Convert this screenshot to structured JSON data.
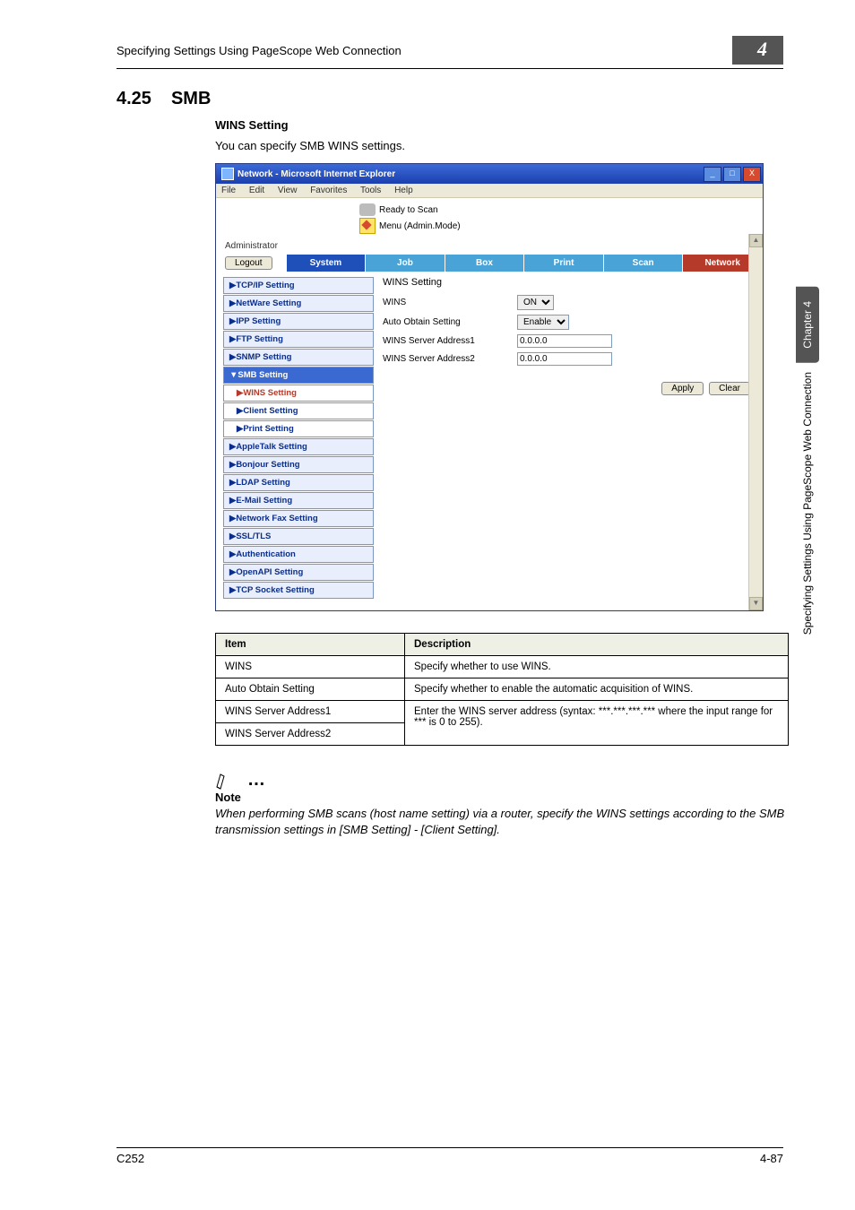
{
  "header": {
    "title": "Specifying Settings Using PageScope Web Connection",
    "badge": "4"
  },
  "section": {
    "number": "4.25",
    "name": "SMB"
  },
  "subheading": "WINS Setting",
  "intro": "You can specify SMB WINS settings.",
  "ie": {
    "title": "Network - Microsoft Internet Explorer",
    "menus": [
      "File",
      "Edit",
      "View",
      "Favorites",
      "Tools",
      "Help"
    ],
    "status1": "Ready to Scan",
    "status2": "Menu (Admin.Mode)",
    "admin_label": "Administrator",
    "logout": "Logout",
    "tabs": {
      "system": "System",
      "job": "Job",
      "box": "Box",
      "print": "Print",
      "scan": "Scan",
      "network": "Network"
    },
    "sidebar": {
      "tcpip": "TCP/IP Setting",
      "netware": "NetWare Setting",
      "ipp": "IPP Setting",
      "ftp": "FTP Setting",
      "snmp": "SNMP Setting",
      "smb": "SMB Setting",
      "wins": "WINS Setting",
      "client": "Client Setting",
      "print": "Print Setting",
      "appletalk": "AppleTalk Setting",
      "bonjour": "Bonjour Setting",
      "ldap": "LDAP Setting",
      "email": "E-Mail Setting",
      "netfax": "Network Fax Setting",
      "ssltls": "SSL/TLS",
      "auth": "Authentication",
      "openapi": "OpenAPI Setting",
      "tcpsock": "TCP Socket Setting"
    },
    "main": {
      "heading": "WINS Setting",
      "row1": {
        "label": "WINS",
        "value": "ON"
      },
      "row2": {
        "label": "Auto Obtain Setting",
        "value": "Enable"
      },
      "row3": {
        "label": "WINS Server Address1",
        "value": "0.0.0.0"
      },
      "row4": {
        "label": "WINS Server Address2",
        "value": "0.0.0.0"
      },
      "apply": "Apply",
      "clear": "Clear"
    }
  },
  "table": {
    "h1": "Item",
    "h2": "Description",
    "r1c1": "WINS",
    "r1c2": "Specify whether to use WINS.",
    "r2c1": "Auto Obtain Setting",
    "r2c2": "Specify whether to enable the automatic acquisition of WINS.",
    "r3c1": "WINS Server Address1",
    "r3c2": "Enter the WINS server address (syntax: ***.***.***.*** where the input range for *** is 0 to 255).",
    "r4c1": "WINS Server Address2"
  },
  "note": {
    "label": "Note",
    "body": "When performing SMB scans (host name setting) via a router, specify the WINS settings according to the SMB transmission settings in [SMB Setting] - [Client Setting]."
  },
  "sidetab": {
    "chapter": "Chapter 4",
    "text": "Specifying Settings Using PageScope Web Connection"
  },
  "footer": {
    "left": "C252",
    "right": "4-87"
  }
}
